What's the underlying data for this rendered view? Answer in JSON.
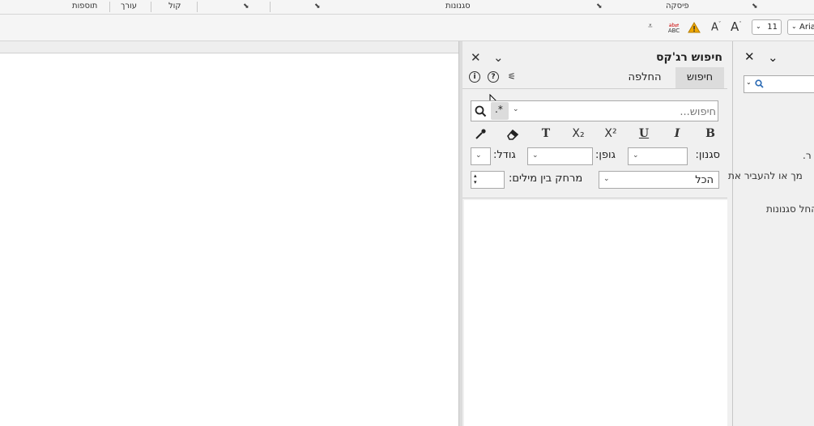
{
  "ribbon": {
    "groups": [
      "תוספות",
      "עורך",
      "קול",
      "סגנונות",
      "פיסקה"
    ]
  },
  "toolbar": {
    "font_size": "11",
    "font_name": "Aria",
    "spell_label": "ABC",
    "grow_font": "A",
    "shrink_font": "A"
  },
  "regex_pane": {
    "title": "חיפוש רג'קס",
    "tabs": {
      "search": "חיפוש",
      "replace": "החלפה"
    },
    "search_placeholder": "חיפוש...",
    "format_buttons": {
      "bold": "B",
      "italic": "I",
      "underline": "U",
      "superscript": "X²",
      "subscript": "X₂",
      "plain": "T"
    },
    "labels": {
      "style": "סגנון:",
      "font": "גופן:",
      "size": "גודל:",
      "word_spacing": "מרחק בין מילים:"
    },
    "scope_value": "הכל"
  },
  "styles_pane": {
    "lines": [
      "ר.",
      "מך או להעביר את",
      "החל סגנונות"
    ]
  },
  "colors": {
    "accent": "#2f6db5",
    "warning": "#f0a800"
  }
}
